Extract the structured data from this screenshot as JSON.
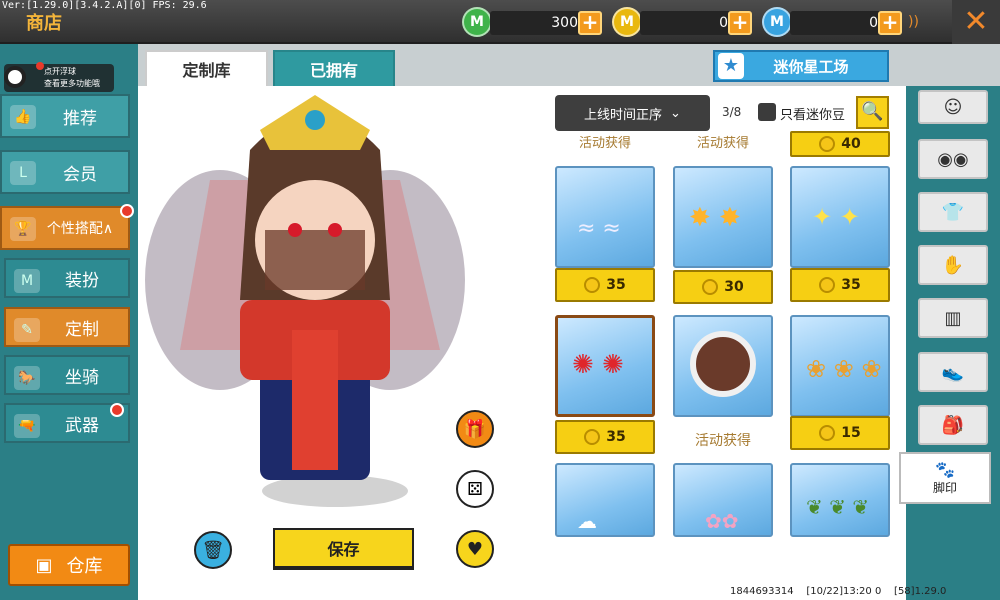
{
  "version_text": "Ver:[1.29.0][3.4.2.A][0] FPS: 29.6",
  "title": "商店",
  "currencies": [
    {
      "icon": "mini-coin-green-icon",
      "symbol": "M",
      "value": "300",
      "color": "#3fb34a"
    },
    {
      "icon": "mini-bean-gold-icon",
      "symbol": "M",
      "value": "0",
      "color": "#e9b80f"
    },
    {
      "icon": "mini-point-blue-icon",
      "symbol": "M",
      "value": "0",
      "color": "#38a3e0"
    }
  ],
  "float_hint": {
    "line1": "点开浮球",
    "line2": "查看更多功能哦"
  },
  "nav": [
    {
      "label": "推荐",
      "icon": "thumb-up-icon",
      "glyph": "👍"
    },
    {
      "label": "会员",
      "icon": "vip-l-icon",
      "glyph": "L"
    },
    {
      "label": "个性搭配∧",
      "icon": "trophy-icon",
      "glyph": "🏆"
    },
    {
      "label": "装扮",
      "icon": "shirt-icon",
      "glyph": "M"
    },
    {
      "label": "定制",
      "icon": "brush-icon",
      "glyph": "✎"
    },
    {
      "label": "坐骑",
      "icon": "mount-icon",
      "glyph": "🐎"
    },
    {
      "label": "武器",
      "icon": "gun-icon",
      "glyph": "🔫"
    }
  ],
  "warehouse_label": "仓库",
  "tabs": [
    "定制库",
    "已拥有"
  ],
  "workshop_label": "迷你星工场",
  "sort_label": "上线时间正序",
  "page_indicator": "3/8",
  "only_minibean_label": "只看迷你豆",
  "top_row_labels": [
    "活动获得",
    "活动获得",
    "40"
  ],
  "items": [
    {
      "price": "35",
      "art": "feather-icon",
      "art_color": "#8fd0ff"
    },
    {
      "price": "30",
      "art": "flame-icon",
      "art_color": "#ffb42a"
    },
    {
      "price": "35",
      "art": "spark-icon",
      "art_color": "#ffe24a"
    },
    {
      "price": "35",
      "art": "red-flower-icon",
      "art_color": "#e0262b",
      "selected": true
    },
    {
      "price": "活动获得",
      "art": "paw-ball-icon",
      "art_color": "#6a3a2a",
      "activity": true
    },
    {
      "price": "15",
      "art": "paw-print-icon",
      "art_color": "#e8a030"
    },
    {
      "price": "",
      "art": "cloud-icon",
      "art_color": "#ffffff"
    },
    {
      "price": "",
      "art": "pink-petal-icon",
      "art_color": "#f3a3c3"
    },
    {
      "price": "",
      "art": "leaf-icon",
      "art_color": "#4a8a2a"
    }
  ],
  "save_label": "保存",
  "categories": [
    {
      "icon": "face-icon",
      "glyph": "☺"
    },
    {
      "icon": "mask-icon",
      "glyph": "◉◉"
    },
    {
      "icon": "shirt-m-icon",
      "glyph": "👕"
    },
    {
      "icon": "glove-icon",
      "glyph": "✋"
    },
    {
      "icon": "pants-icon",
      "glyph": "▥"
    },
    {
      "icon": "shoes-icon",
      "glyph": "👟"
    },
    {
      "icon": "backpack-icon",
      "glyph": "🎒"
    }
  ],
  "footprint_label": "脚印",
  "footer": {
    "uid": "1844693314",
    "time": "[10/22]13:20 0",
    "ver": "[58]1.29.0"
  }
}
